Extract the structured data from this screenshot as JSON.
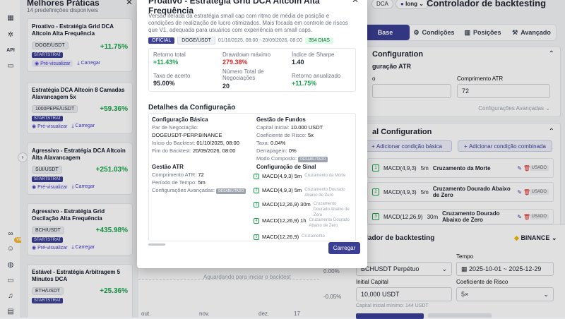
{
  "left_panel": {
    "title": "Melhores Práticas",
    "subtitle": "14 predefinições disponíveis",
    "cards": [
      {
        "title": "Proativo - Estratégia Grid DCA Altcoin Alta Frequência",
        "pair": "DOGE/USDT",
        "return": "+11.75%",
        "badge": "STARTSTRAT",
        "preview": "Pré-visualizar",
        "load": "Carregar"
      },
      {
        "title": "Estratégia DCA Altcoin 8 Camadas Alavancagem 5x",
        "pair": "1000PEPE/USDT",
        "return": "+59.36%",
        "badge": "STARTSTRAT",
        "preview": "Pré-visualizar",
        "load": "Carregar"
      },
      {
        "title": "Agressivo - Estratégia DCA Altcoin Alta Alavancagem",
        "pair": "SUI/USDT",
        "return": "+251.03%",
        "badge": "STARTSTRAT",
        "preview": "Pré-visualizar",
        "load": "Carregar"
      },
      {
        "title": "Agressivo - Estratégia Grid Oscilação Alta Frequência",
        "pair": "BCH/USDT",
        "return": "+435.98%",
        "badge": "STARTSTRAT",
        "preview": "Pré-visualizar",
        "load": "Carregar"
      },
      {
        "title": "Estável - Estratégia Arbitragem 5 Minutos DCA",
        "pair": "ETH/USDT",
        "return": "+25.36%",
        "badge": "STARTSTRAT",
        "preview": "",
        "load": ""
      }
    ]
  },
  "rail": {
    "api_label": "API",
    "vip_label": "VIP"
  },
  "header": {
    "chip_dca": "DCA",
    "chip_long": "long",
    "title": "Controlador de backtesting"
  },
  "tabs": [
    "Base",
    "Condições",
    "Posições",
    "Avançado"
  ],
  "config_panel": {
    "title": "Configuration",
    "atr_title": "guração ATR",
    "atr_left_label": "o",
    "atr_length_label": "Comprimento ATR",
    "atr_length_value": "72",
    "advanced_label": "Configurações Avançadas"
  },
  "signal_panel": {
    "title": "al Configuration",
    "add_basic": "Adicionar condição básica",
    "add_combined": "Adicionar condição combinada",
    "conditions": [
      {
        "num": "1",
        "ind": "MACD(4,9,3)",
        "tf": "5m",
        "name": "Cruzamento da Morte",
        "tag": "USADO"
      },
      {
        "num": "2",
        "ind": "MACD(4,9,3)",
        "tf": "5m",
        "name": "Cruzamento Dourado Abaixo de Zero",
        "tag": "USADO"
      },
      {
        "num": "3",
        "ind": "MACD(12,26,9)",
        "tf": "30m",
        "name": "Cruzamento Dourado Abaixo de Zero",
        "tag": "USADO"
      }
    ]
  },
  "bottom": {
    "title": "olador de backtesting",
    "exchange": "BINANCE",
    "time_label": "Tempo",
    "symbol": "BCHUSDT Perpétuo",
    "date_range": "2025-10-01 ~ 2025-12-29",
    "capital_label": "Initial Capital",
    "capital_value": "10,000 USDT",
    "risk_label": "Coeficiente de Risco",
    "risk_value": "5×",
    "min_capital": "Capital inicial mínimo: 144 USDT"
  },
  "chart_bg": {
    "waiting": "Aguardando para iniciar o backtest",
    "y1": "0.00%",
    "y2": "-0.05%",
    "x_labels": [
      "out.",
      "nov.",
      "dez.",
      "17"
    ]
  },
  "modal": {
    "title": "Proativo - Estratégia Grid DCA Altcoin Alta Frequência",
    "description": "Versão iterada da estratégia small cap com ritmo de média de posição e condições de realização de lucro otimizados. Mais focada em controle de riscos que V1, adequada para usuários com experiência em small caps.",
    "tag_official": "OFICIAL",
    "tag_pair": "DOGE/USDT",
    "period": "01/10/2025, 08:00 - 20/09/2026, 08:00",
    "days": "354 DIAS",
    "stats": [
      {
        "label": "Retorno total",
        "value": "+11.43%",
        "color": "#16a34a"
      },
      {
        "label": "Drawdown máximo",
        "value": "279.38%",
        "color": "#dc2626"
      },
      {
        "label": "Índice de Sharpe",
        "value": "1.40",
        "color": "#111827"
      },
      {
        "label": "Taxa de acerto",
        "value": "95.00%",
        "color": "#111827"
      },
      {
        "label": "Número Total de Negociações",
        "value": "20",
        "color": "#111827"
      },
      {
        "label": "Retorno anualizado",
        "value": "+11.75%",
        "color": "#16a34a"
      }
    ],
    "details_title": "Detalhes da Configuração",
    "basic": {
      "title": "Configuração Básica",
      "pair_label": "Par de Negociação:",
      "pair_value": "DOGEUSDT-PERP.BINANCE",
      "start_label": "Início do Backtest:",
      "start_value": "01/10/2025, 08:00",
      "end_label": "Fim do Backtest:",
      "end_value": "20/09/2026, 08:00"
    },
    "atr": {
      "title": "Gestão ATR",
      "len_label": "Comprimento ATR:",
      "len_value": "72",
      "period_label": "Período de Tempo:",
      "period_value": "5m",
      "adv_label": "Configurações Avançadas:",
      "adv_value": "DESABILITADO"
    },
    "funds": {
      "title": "Gestão de Fundos",
      "cap_label": "Capital Inicial:",
      "cap_value": "10.000 USDT",
      "risk_label": "Coeficiente de Risco:",
      "risk_value": "5x",
      "fee_label": "Taxa:",
      "fee_value": "0.04%",
      "slip_label": "Derrapagem:",
      "slip_value": "0%",
      "comp_label": "Modo Composto:",
      "comp_value": "DESABILITADO"
    },
    "signals": {
      "title": "Configuração de Sinal",
      "items": [
        {
          "num": "1",
          "ind": "MACD(4,9,3) 5m",
          "desc": "Cruzamento da Morte"
        },
        {
          "num": "2",
          "ind": "MACD(4,9,3) 5m",
          "desc": "Cruzamento Dourado Abaixo de Zero"
        },
        {
          "num": "3",
          "ind": "MACD(12,26,9) 30m",
          "desc": "Cruzamento Dourado Abaixo de Zero"
        },
        {
          "num": "4",
          "ind": "MACD(12,26,9) 1h",
          "desc": "Cruzamento Dourado Abaixo de Zero"
        },
        {
          "num": "5",
          "ind": "MACD(12,26,9)",
          "desc": "Cruzamento"
        }
      ]
    },
    "load_button": "Carregar"
  }
}
